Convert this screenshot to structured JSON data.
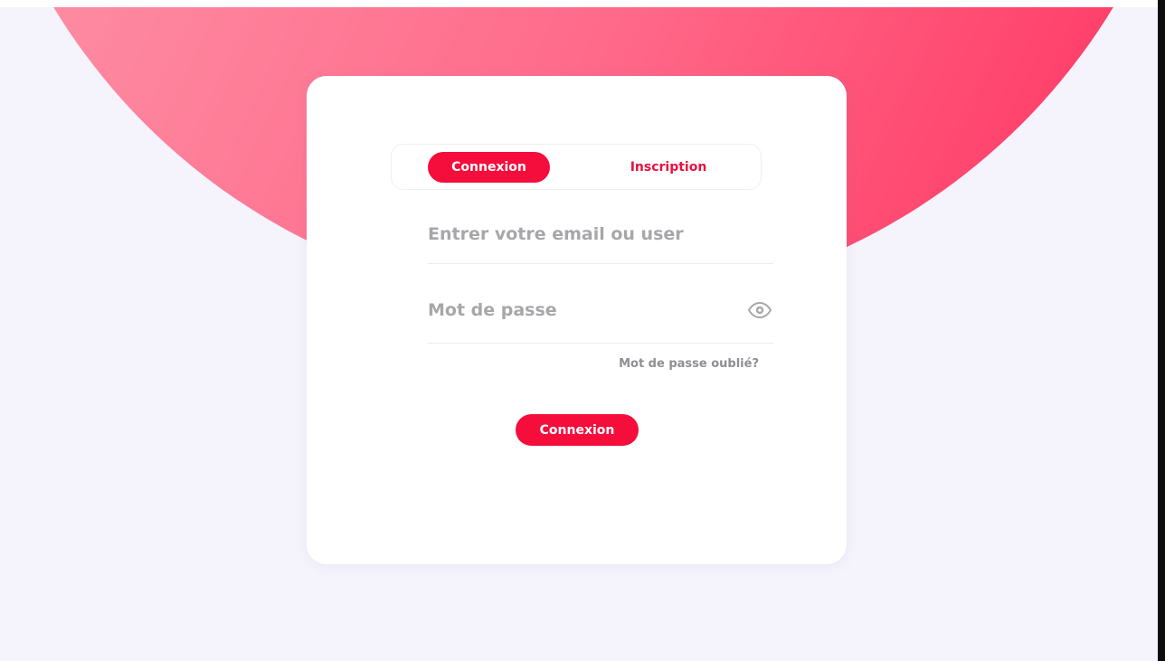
{
  "colors": {
    "accent": "#f50d3c",
    "background": "#f5f4fd",
    "card": "#ffffff",
    "muted_text": "#a7a7aa"
  },
  "tabs": {
    "login_label": "Connexion",
    "signup_label": "Inscription",
    "active": "login"
  },
  "form": {
    "email_placeholder": "Entrer votre email ou user",
    "email_value": "",
    "password_placeholder": "Mot de passe",
    "password_value": "",
    "password_toggle_icon": "eye-icon",
    "forgot_label": "Mot de passe oublié?",
    "submit_label": "Connexion"
  }
}
